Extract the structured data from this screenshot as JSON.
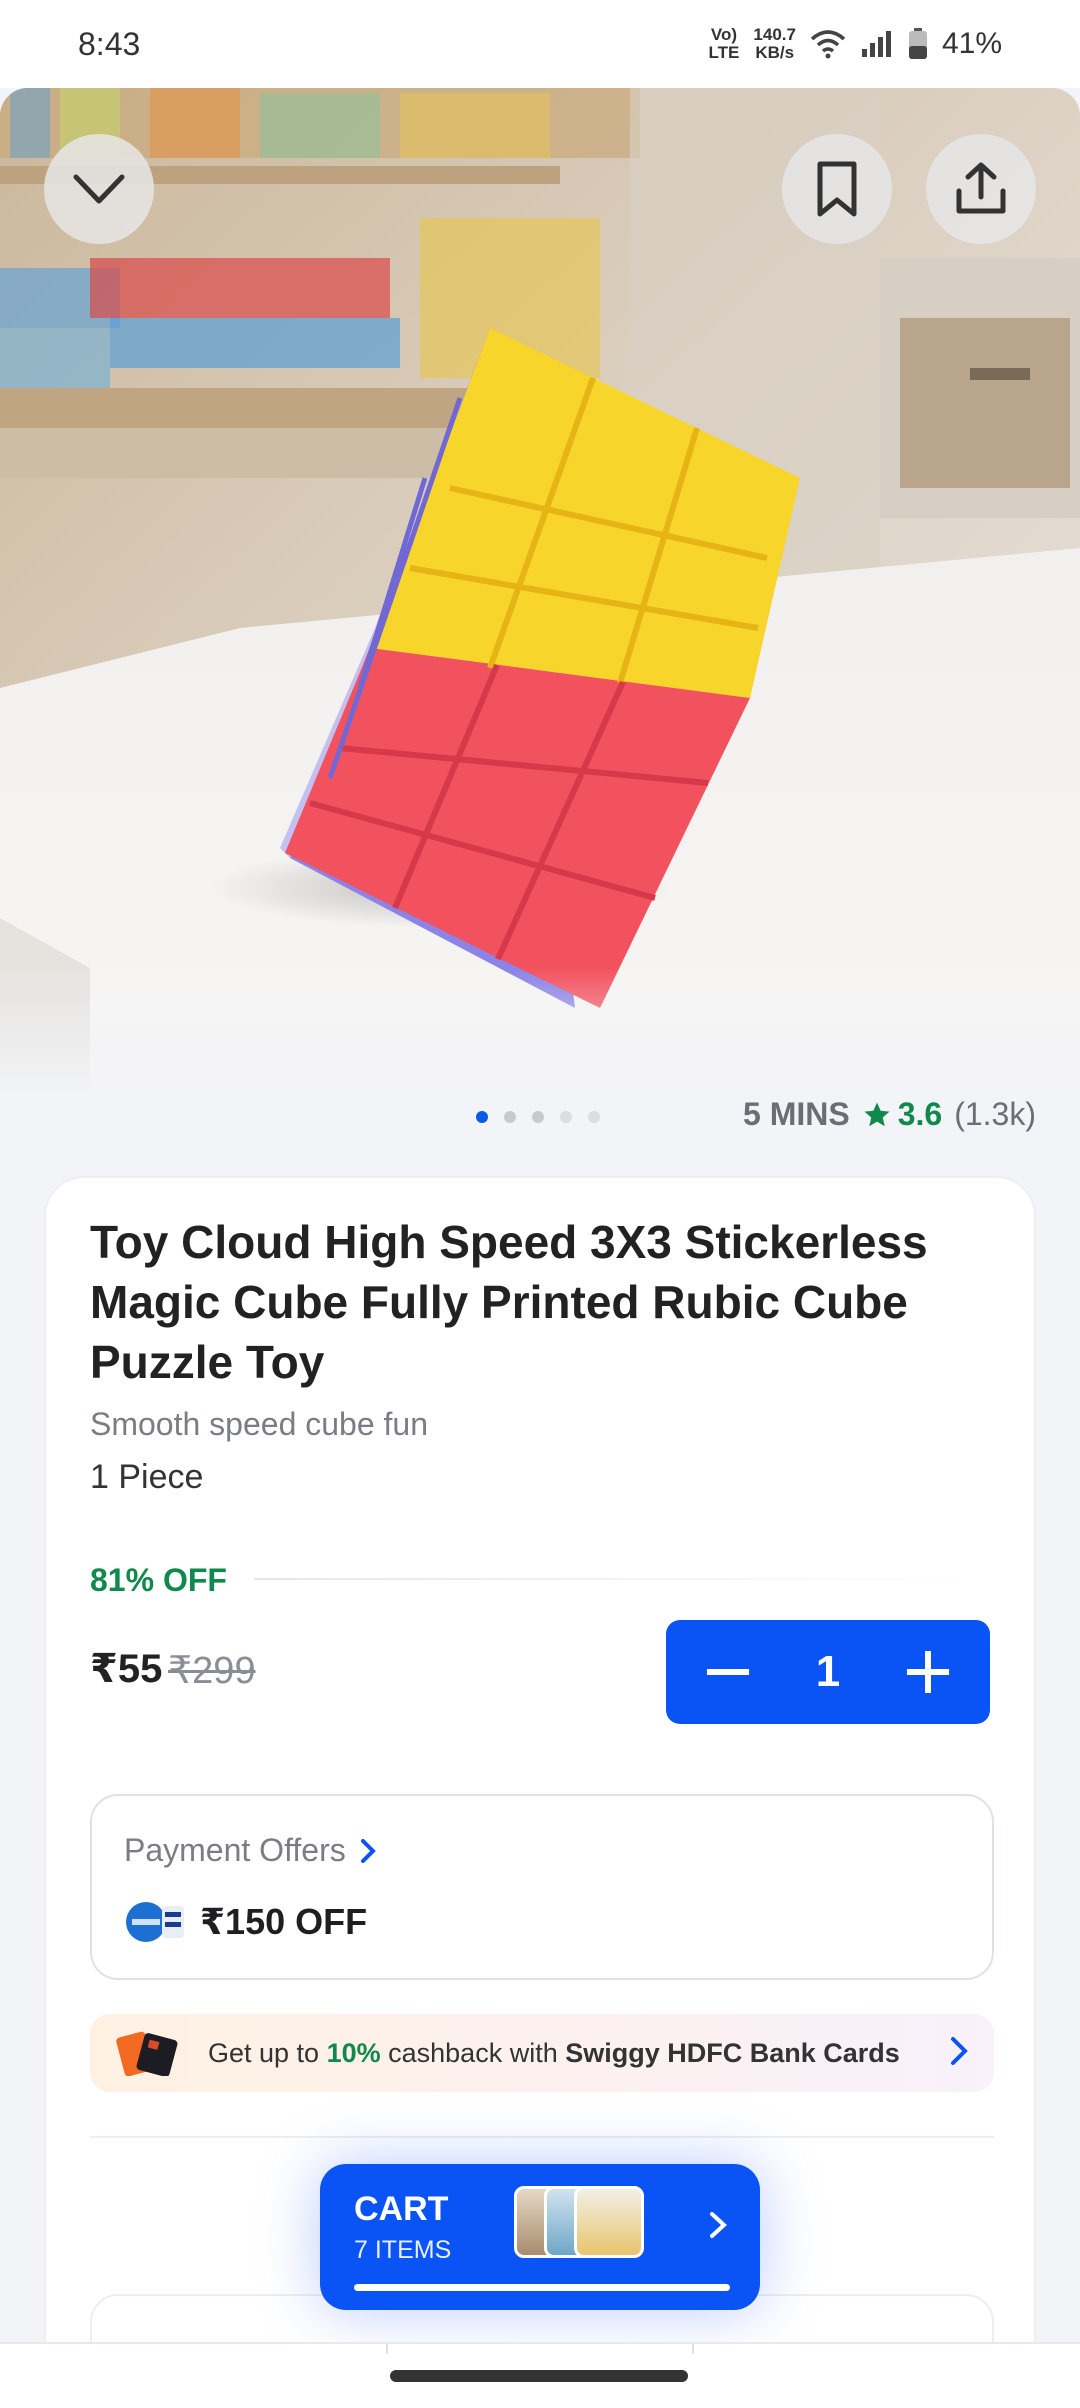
{
  "status_bar": {
    "time": "8:43",
    "network_label": "VoLTE",
    "speed_value": "140.7",
    "speed_unit": "KB/s",
    "battery": "41%"
  },
  "hero": {
    "icons": [
      "chevron-down-icon",
      "bookmark-icon",
      "share-icon"
    ],
    "dots_total": 5,
    "dots_active": 0
  },
  "meta": {
    "delivery_time": "5 MINS",
    "rating": "3.6",
    "rating_count": "(1.3k)"
  },
  "product": {
    "title": "Toy Cloud High Speed 3X3 Stickerless Magic Cube Fully Printed Rubic Cube Puzzle Toy",
    "subtitle": "Smooth speed cube fun",
    "quantity_label": "1 Piece",
    "discount": "81% OFF",
    "price": "₹55",
    "mrp": "₹299",
    "cart_qty": "1"
  },
  "payment": {
    "title": "Payment Offers",
    "offer": "₹150 OFF"
  },
  "cashback": {
    "prefix": "Get up to ",
    "highlight": "10%",
    "middle": " cashback with ",
    "brand": "Swiggy HDFC Bank Cards"
  },
  "cart": {
    "label": "CART",
    "items": "7 ITEMS"
  },
  "colors": {
    "accent": "#0a53f5",
    "green": "#0f8a4c",
    "cube_yellow": "#f8d52b",
    "cube_red": "#f2525e",
    "cube_purple": "#8b83e6"
  }
}
